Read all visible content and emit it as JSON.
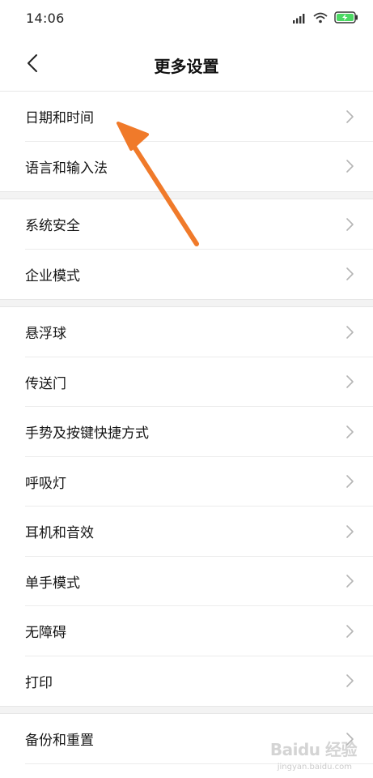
{
  "status_bar": {
    "time": "14:06",
    "icons": [
      "signal-icon",
      "wifi-icon",
      "battery-charging-icon"
    ]
  },
  "header": {
    "back_icon": "chevron-left-icon",
    "title": "更多设置"
  },
  "sections": [
    {
      "items": [
        {
          "label": "日期和时间"
        },
        {
          "label": "语言和输入法"
        }
      ]
    },
    {
      "items": [
        {
          "label": "系统安全"
        },
        {
          "label": "企业模式"
        }
      ]
    },
    {
      "items": [
        {
          "label": "悬浮球"
        },
        {
          "label": "传送门"
        },
        {
          "label": "手势及按键快捷方式"
        },
        {
          "label": "呼吸灯"
        },
        {
          "label": "耳机和音效"
        },
        {
          "label": "单手模式"
        },
        {
          "label": "无障碍"
        },
        {
          "label": "打印"
        }
      ]
    },
    {
      "items": [
        {
          "label": "备份和重置"
        }
      ]
    }
  ],
  "annotation": {
    "color": "#F07A2A",
    "icon": "arrow-annotation-icon"
  },
  "watermark": {
    "text": "Baidu 经验",
    "sub": "jingyan.baidu.com"
  },
  "colors": {
    "chevron": "#b5b5b5",
    "gap": "#f3f3f3"
  }
}
